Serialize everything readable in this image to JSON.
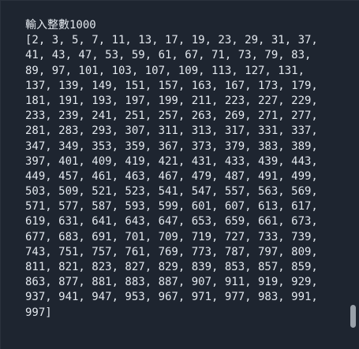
{
  "console": {
    "prompt": "輸入整數1000",
    "output_lines": [
      "[2, 3, 5, 7, 11, 13, 17, 19, 23, 29, 31, 37,",
      "41, 43, 47, 53, 59, 61, 67, 71, 73, 79, 83,",
      "89, 97, 101, 103, 107, 109, 113, 127, 131,",
      "137, 139, 149, 151, 157, 163, 167, 173, 179,",
      "181, 191, 193, 197, 199, 211, 223, 227, 229,",
      "233, 239, 241, 251, 257, 263, 269, 271, 277,",
      "281, 283, 293, 307, 311, 313, 317, 331, 337,",
      "347, 349, 353, 359, 367, 373, 379, 383, 389,",
      "397, 401, 409, 419, 421, 431, 433, 439, 443,",
      "449, 457, 461, 463, 467, 479, 487, 491, 499,",
      "503, 509, 521, 523, 541, 547, 557, 563, 569,",
      "571, 577, 587, 593, 599, 601, 607, 613, 617,",
      "619, 631, 641, 643, 647, 653, 659, 661, 673,",
      "677, 683, 691, 701, 709, 719, 727, 733, 739,",
      "743, 751, 757, 761, 769, 773, 787, 797, 809,",
      "811, 821, 823, 827, 829, 839, 853, 857, 859,",
      "863, 877, 881, 883, 887, 907, 911, 919, 929,",
      "937, 941, 947, 953, 967, 971, 977, 983, 991,",
      "997]"
    ]
  },
  "scrollbar": {
    "position": 0.95
  },
  "colors": {
    "background": "#1e2530",
    "text": "#e3e8ee",
    "scrollbar_thumb": "#9aa1aa"
  }
}
